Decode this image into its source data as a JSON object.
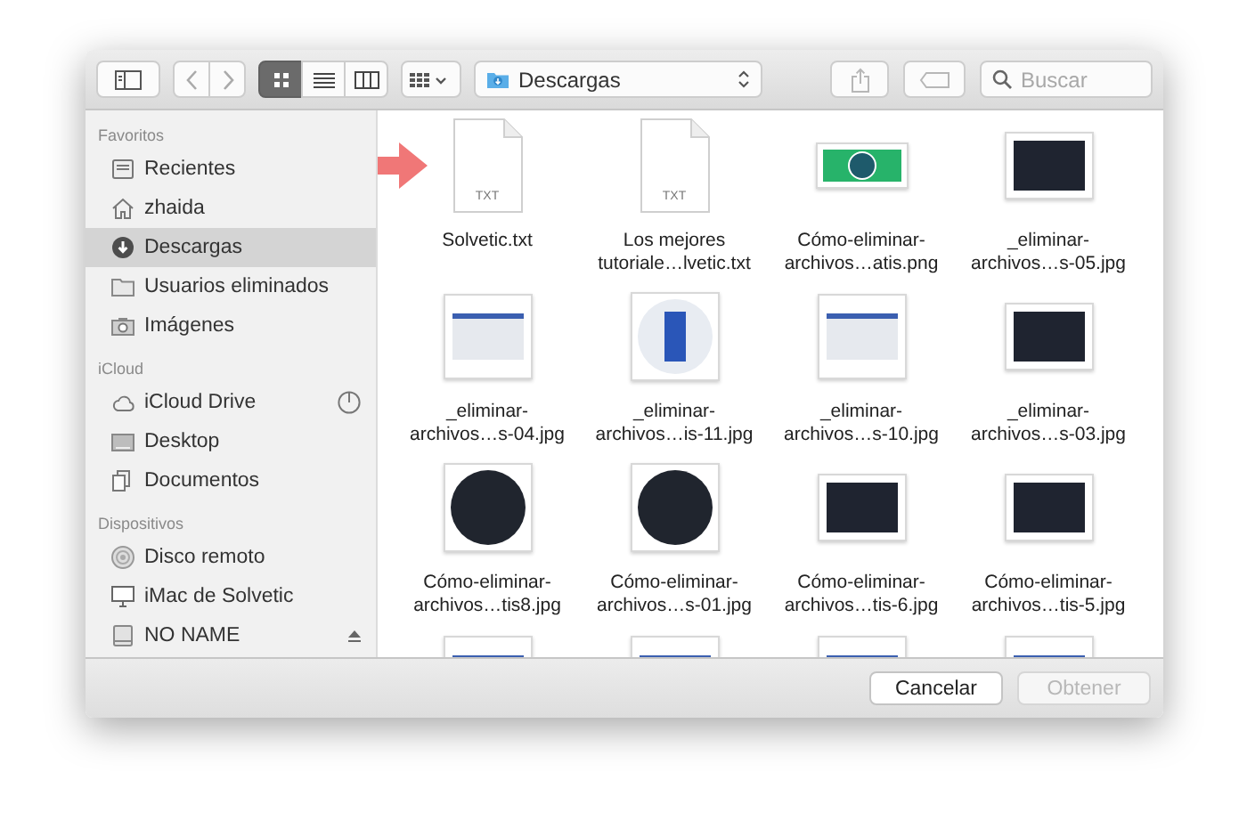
{
  "toolbar": {
    "view_modes": [
      {
        "kind": "icons",
        "selected": true
      },
      {
        "kind": "list",
        "selected": false
      },
      {
        "kind": "columns",
        "selected": false
      }
    ],
    "location": "Descargas",
    "share_disabled": true,
    "tags_disabled": true,
    "search": {
      "placeholder": "Buscar"
    }
  },
  "sidebar": [
    {
      "title": "Favoritos",
      "items": [
        {
          "label": "Recientes",
          "kind": "recents",
          "selected": false
        },
        {
          "label": "zhaida",
          "kind": "home",
          "selected": false
        },
        {
          "label": "Descargas",
          "kind": "downloads",
          "selected": true
        },
        {
          "label": "Usuarios eliminados",
          "kind": "folder",
          "selected": false
        },
        {
          "label": "Imágenes",
          "kind": "pictures",
          "selected": false
        }
      ]
    },
    {
      "title": "iCloud",
      "items": [
        {
          "label": "iCloud Drive",
          "kind": "cloud",
          "selected": false,
          "syncing": true
        },
        {
          "label": "Desktop",
          "kind": "desktop",
          "selected": false
        },
        {
          "label": "Documentos",
          "kind": "documents",
          "selected": false
        }
      ]
    },
    {
      "title": "Dispositivos",
      "items": [
        {
          "label": "Disco remoto",
          "kind": "disc",
          "selected": false
        },
        {
          "label": "iMac de Solvetic",
          "kind": "computer",
          "selected": false
        },
        {
          "label": "NO NAME",
          "kind": "drive",
          "selected": false,
          "ejectable": true
        }
      ]
    }
  ],
  "files": [
    {
      "name": "Solvetic.txt",
      "kind": "doc",
      "badge": "TXT"
    },
    {
      "name": "Los mejores\ntutoriale…lvetic.txt",
      "kind": "doc",
      "badge": "TXT"
    },
    {
      "name": "Cómo-eliminar-\narchivos…atis.png",
      "kind": "banner"
    },
    {
      "name": "_eliminar-\narchivos…s-05.jpg",
      "kind": "screenshot-dark"
    },
    {
      "name": "_eliminar-\narchivos…s-04.jpg",
      "kind": "screenshot-light"
    },
    {
      "name": "_eliminar-\narchivos…is-11.jpg",
      "kind": "round-light"
    },
    {
      "name": "_eliminar-\narchivos…s-10.jpg",
      "kind": "screenshot-light"
    },
    {
      "name": "_eliminar-\narchivos…s-03.jpg",
      "kind": "screenshot-dark"
    },
    {
      "name": "Cómo-eliminar-\narchivos…tis8.jpg",
      "kind": "round-dark"
    },
    {
      "name": "Cómo-eliminar-\narchivos…s-01.jpg",
      "kind": "round-dark"
    },
    {
      "name": "Cómo-eliminar-\narchivos…tis-6.jpg",
      "kind": "screenshot-dark"
    },
    {
      "name": "Cómo-eliminar-\narchivos…tis-5.jpg",
      "kind": "screenshot-dark"
    },
    {
      "kind": "screenshot-light"
    },
    {
      "kind": "screenshot-light"
    },
    {
      "kind": "screenshot-light"
    },
    {
      "kind": "screenshot-light"
    }
  ],
  "buttons": [
    {
      "label": "Cancelar",
      "disabled": false
    },
    {
      "label": "Obtener",
      "disabled": true
    }
  ]
}
